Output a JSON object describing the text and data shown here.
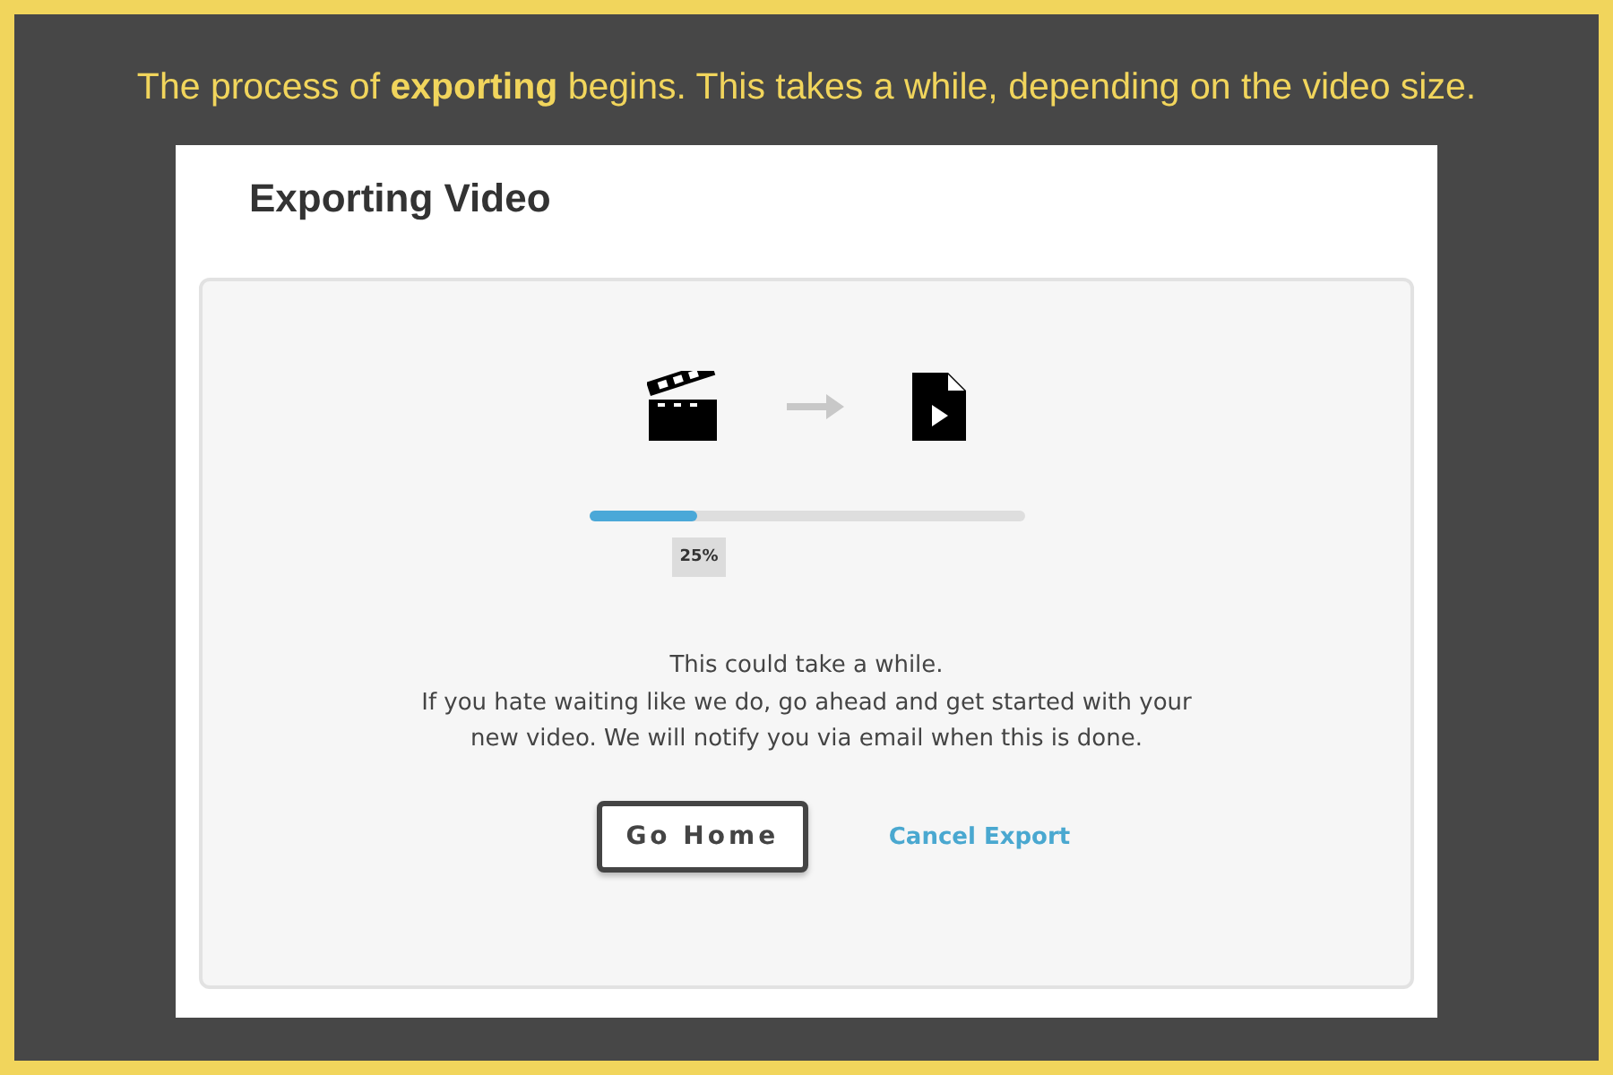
{
  "caption": "The process of **exporting** begins. This takes a while, depending on the video size.",
  "dialog": {
    "title": "Exporting Video",
    "progress": {
      "level": 0.25,
      "reading": "25%"
    },
    "message_title": "This could take a while.",
    "message": "If you hate waiting like we do, go ahead and get started with your new video. We will notify you via email when this is done.",
    "buttons": [
      {
        "label": "Go Home",
        "kind": "outlined"
      },
      {
        "label": "Cancel Export",
        "kind": "link"
      }
    ]
  }
}
